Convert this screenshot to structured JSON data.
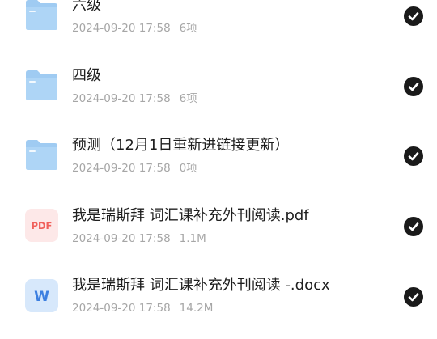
{
  "files": [
    {
      "name": "六级",
      "date": "2024-09-20 17:58",
      "size": "6项",
      "type": "folder-icon"
    },
    {
      "name": "四级",
      "date": "2024-09-20 17:58",
      "size": "6项",
      "type": "folder-icon"
    },
    {
      "name": "预测（12月1日重新进链接更新）",
      "date": "2024-09-20 17:58",
      "size": "0项",
      "type": "folder-icon"
    },
    {
      "name": "我是瑞斯拜 词汇课补充外刊阅读.pdf",
      "date": "2024-09-20 17:58",
      "size": "1.1M",
      "type": "pdf-file-icon",
      "icon_text": "PDF"
    },
    {
      "name": "我是瑞斯拜 词汇课补充外刊阅读 -.docx",
      "date": "2024-09-20 17:58",
      "size": "14.2M",
      "type": "word-file-icon",
      "icon_text": "W"
    }
  ],
  "colors": {
    "folder": "#9fcbf2",
    "pdf_bg": "#fde8e8",
    "pdf_text": "#f0605b",
    "word_bg": "#d7e8fb",
    "word_text": "#3c7fe0",
    "check": "#1a1a1a"
  }
}
